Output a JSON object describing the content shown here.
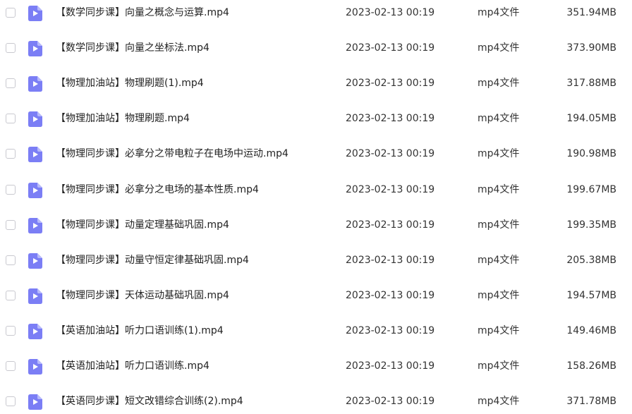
{
  "colors": {
    "icon_bg": "#7b7ef5",
    "icon_fold": "#b7b9fb",
    "checkbox_border": "#c9c9cf"
  },
  "files": [
    {
      "name": "【数学同步课】向量之概念与运算.mp4",
      "date": "2023-02-13 00:19",
      "type": "mp4文件",
      "size": "351.94MB"
    },
    {
      "name": "【数学同步课】向量之坐标法.mp4",
      "date": "2023-02-13 00:19",
      "type": "mp4文件",
      "size": "373.90MB"
    },
    {
      "name": "【物理加油站】物理刷题(1).mp4",
      "date": "2023-02-13 00:19",
      "type": "mp4文件",
      "size": "317.88MB"
    },
    {
      "name": "【物理加油站】物理刷题.mp4",
      "date": "2023-02-13 00:19",
      "type": "mp4文件",
      "size": "194.05MB"
    },
    {
      "name": "【物理同步课】必拿分之带电粒子在电场中运动.mp4",
      "date": "2023-02-13 00:19",
      "type": "mp4文件",
      "size": "190.98MB"
    },
    {
      "name": "【物理同步课】必拿分之电场的基本性质.mp4",
      "date": "2023-02-13 00:19",
      "type": "mp4文件",
      "size": "199.67MB"
    },
    {
      "name": "【物理同步课】动量定理基础巩固.mp4",
      "date": "2023-02-13 00:19",
      "type": "mp4文件",
      "size": "199.35MB"
    },
    {
      "name": "【物理同步课】动量守恒定律基础巩固.mp4",
      "date": "2023-02-13 00:19",
      "type": "mp4文件",
      "size": "205.38MB"
    },
    {
      "name": "【物理同步课】天体运动基础巩固.mp4",
      "date": "2023-02-13 00:19",
      "type": "mp4文件",
      "size": "194.57MB"
    },
    {
      "name": "【英语加油站】听力口语训练(1).mp4",
      "date": "2023-02-13 00:19",
      "type": "mp4文件",
      "size": "149.46MB"
    },
    {
      "name": "【英语加油站】听力口语训练.mp4",
      "date": "2023-02-13 00:19",
      "type": "mp4文件",
      "size": "158.26MB"
    },
    {
      "name": "【英语同步课】短文改错综合训练(2).mp4",
      "date": "2023-02-13 00:19",
      "type": "mp4文件",
      "size": "371.78MB"
    }
  ]
}
